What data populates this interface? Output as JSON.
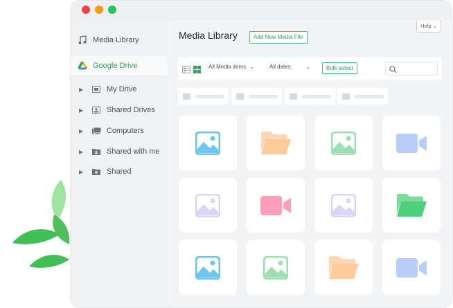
{
  "window": {
    "dots": [
      "#ef4444",
      "#f59e0b",
      "#22c55e"
    ]
  },
  "sidebar": {
    "items": [
      {
        "label": "Media Library",
        "icon": "music-note-icon",
        "active": false
      },
      {
        "label": "Google Drive",
        "icon": "google-drive-icon",
        "active": true
      },
      {
        "label": "My Drive",
        "icon": "drive-icon",
        "expandable": true
      },
      {
        "label": "Shared Drives",
        "icon": "shared-drives-icon",
        "expandable": true
      },
      {
        "label": "Computers",
        "icon": "computers-icon",
        "expandable": true
      },
      {
        "label": "Shared with me",
        "icon": "shared-with-me-icon",
        "expandable": true
      },
      {
        "label": "Shared",
        "icon": "shared-folder-icon",
        "expandable": true
      }
    ]
  },
  "main": {
    "title": "Media Library",
    "add_button": "Add New Media File",
    "help": "Help ⌄",
    "toolbar": {
      "media_filter": "All Media items",
      "date_filter": "All dates",
      "bulk_select": "Bulk select",
      "search_placeholder": ""
    }
  },
  "grid": [
    {
      "type": "image",
      "color": "#6ec6ee"
    },
    {
      "type": "folder",
      "color": "#ffcb9a"
    },
    {
      "type": "image",
      "color": "#9edfb1"
    },
    {
      "type": "video",
      "color": "#b9cdfb"
    },
    {
      "type": "image",
      "color": "#d9d6f8"
    },
    {
      "type": "video",
      "color": "#ff9eb8"
    },
    {
      "type": "image",
      "color": "#d9d6f8"
    },
    {
      "type": "folder",
      "color": "#4fcf7c"
    },
    {
      "type": "image",
      "color": "#6ec6ee"
    },
    {
      "type": "image",
      "color": "#9edfb1"
    },
    {
      "type": "folder",
      "color": "#ffcb9a"
    },
    {
      "type": "video",
      "color": "#b9cdfb"
    }
  ]
}
